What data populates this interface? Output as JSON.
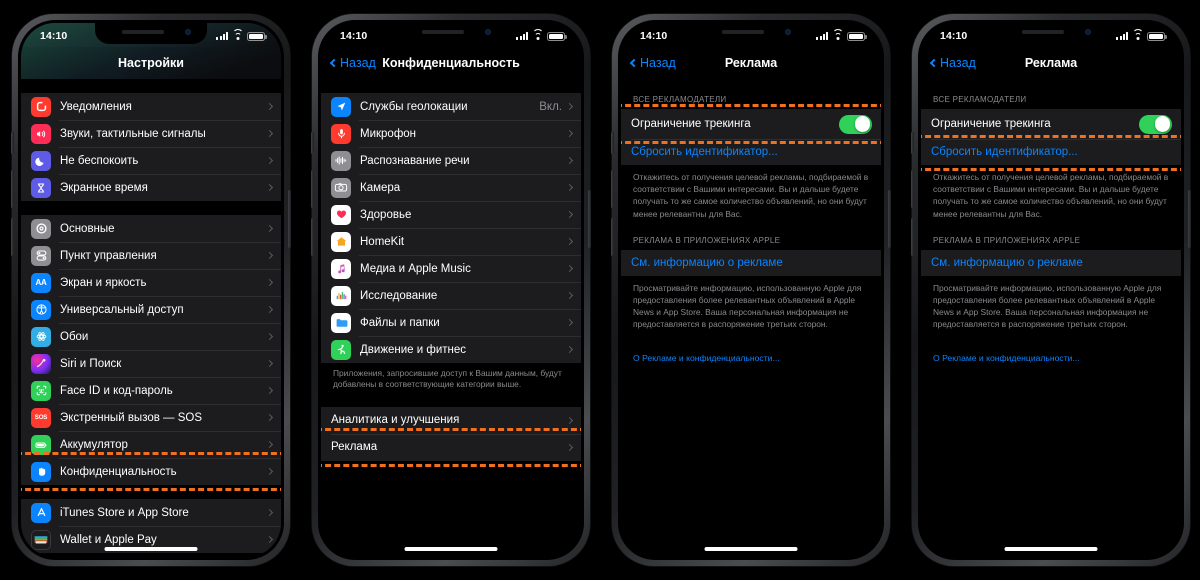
{
  "statusbar": {
    "time": "14:10"
  },
  "phones": [
    {
      "id": "settings",
      "nav": {
        "title": "Настройки",
        "back": null
      },
      "groups": [
        {
          "rows": [
            {
              "icon": "notifications-icon",
              "label": "Уведомления"
            },
            {
              "icon": "sounds-icon",
              "label": "Звуки, тактильные сигналы"
            },
            {
              "icon": "do-not-disturb-icon",
              "label": "Не беспокоить"
            },
            {
              "icon": "screen-time-icon",
              "label": "Экранное время"
            }
          ]
        },
        {
          "rows": [
            {
              "icon": "general-icon",
              "label": "Основные"
            },
            {
              "icon": "control-center-icon",
              "label": "Пункт управления"
            },
            {
              "icon": "display-brightness-icon",
              "label": "Экран и яркость"
            },
            {
              "icon": "accessibility-icon",
              "label": "Универсальный доступ"
            },
            {
              "icon": "wallpaper-icon",
              "label": "Обои"
            },
            {
              "icon": "siri-search-icon",
              "label": "Siri и Поиск"
            },
            {
              "icon": "face-id-icon",
              "label": "Face ID и код-пароль"
            },
            {
              "icon": "sos-icon",
              "label": "Экстренный вызов — SOS"
            },
            {
              "icon": "battery-icon",
              "label": "Аккумулятор"
            },
            {
              "icon": "privacy-icon",
              "label": "Конфиденциальность",
              "highlighted": true
            }
          ]
        },
        {
          "rows": [
            {
              "icon": "itunes-store-icon",
              "label": "iTunes Store и App Store"
            },
            {
              "icon": "wallet-icon",
              "label": "Wallet и Apple Pay"
            }
          ]
        }
      ]
    },
    {
      "id": "privacy",
      "nav": {
        "title": "Конфиденциальность",
        "back": "Назад"
      },
      "groups": [
        {
          "rows": [
            {
              "icon": "location-services-icon",
              "label": "Службы геолокации",
              "value": "Вкл."
            },
            {
              "icon": "microphone-icon",
              "label": "Микрофон"
            },
            {
              "icon": "speech-recognition-icon",
              "label": "Распознавание речи"
            },
            {
              "icon": "camera-icon",
              "label": "Камера"
            },
            {
              "icon": "health-icon",
              "label": "Здоровье"
            },
            {
              "icon": "homekit-icon",
              "label": "HomeKit"
            },
            {
              "icon": "media-apple-music-icon",
              "label": "Медиа и Apple Music"
            },
            {
              "icon": "research-icon",
              "label": "Исследование"
            },
            {
              "icon": "files-folders-icon",
              "label": "Файлы и папки"
            },
            {
              "icon": "motion-fitness-icon",
              "label": "Движение и фитнес"
            }
          ]
        },
        {
          "footnote": "Приложения, запросившие доступ к Вашим данным, будут добавлены в соответствующие категории выше."
        },
        {
          "rows": [
            {
              "label": "Аналитика и улучшения"
            },
            {
              "label": "Реклама",
              "highlighted": true
            }
          ]
        }
      ]
    },
    {
      "id": "advertising-toggle",
      "nav": {
        "title": "Реклама",
        "back": "Назад"
      },
      "section_header_1": "ВСЕ РЕКЛАМОДАТЕЛИ",
      "toggle_row": {
        "label": "Ограничение трекинга",
        "state": "on",
        "highlighted": true
      },
      "reset_link": "Сбросить идентификатор...",
      "body_text_1": "Откажитесь от получения целевой рекламы, подбираемой в соответствии с Вашими интересами. Вы и дальше будете получать то же самое количество объявлений, но они будут менее релевантны для Вас.",
      "section_header_2": "РЕКЛАМА В ПРИЛОЖЕНИЯХ APPLE",
      "info_link": "См. информацию о рекламе",
      "body_text_2": "Просматривайте информацию, использованную Apple для предоставления более релевантных объявлений в Apple News и App Store. Ваша персональная информация не предоставляется в распоряжение третьих сторон.",
      "footer_link": "О Рекламе и конфиденциальности...",
      "reset_highlighted": false
    },
    {
      "id": "advertising-reset",
      "nav": {
        "title": "Реклама",
        "back": "Назад"
      },
      "section_header_1": "ВСЕ РЕКЛАМОДАТЕЛИ",
      "toggle_row": {
        "label": "Ограничение трекинга",
        "state": "on",
        "highlighted": false
      },
      "reset_link": "Сбросить идентификатор...",
      "body_text_1": "Откажитесь от получения целевой рекламы, подбираемой в соответствии с Вашими интересами. Вы и дальше будете получать то же самое количество объявлений, но они будут менее релевантны для Вас.",
      "section_header_2": "РЕКЛАМА В ПРИЛОЖЕНИЯХ APPLE",
      "info_link": "См. информацию о рекламе",
      "body_text_2": "Просматривайте информацию, использованную Apple для предоставления более релевантных объявлений в Apple News и App Store. Ваша персональная информация не предоставляется в распоряжение третьих сторон.",
      "footer_link": "О Рекламе и конфиденциальности...",
      "reset_highlighted": true
    }
  ],
  "colors": {
    "highlight": "#f07020",
    "accent_blue": "#0a84ff",
    "toggle_on": "#30d158",
    "group_bg": "#1c1c1e",
    "secondary_text": "#8a8a8e"
  }
}
